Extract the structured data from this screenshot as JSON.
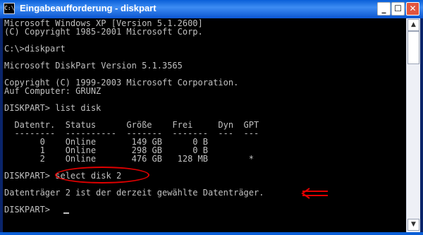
{
  "window": {
    "title": "Eingabeaufforderung - diskpart",
    "icon_text": "C:\\",
    "minimize_glyph": "_",
    "maximize_glyph": "☐",
    "close_glyph": "✕"
  },
  "console": {
    "lines": [
      "Microsoft Windows XP [Version 5.1.2600]",
      "(C) Copyright 1985-2001 Microsoft Corp.",
      "",
      "C:\\>diskpart",
      "",
      "Microsoft DiskPart Version 5.1.3565",
      "",
      "Copyright (C) 1999-2003 Microsoft Corporation.",
      "Auf Computer: GRUNZ",
      "",
      "DISKPART> list disk",
      "",
      "  Datentr.  Status      Größe    Frei     Dyn  GPT",
      "  --------  ----------  -------  -------  ---  ---",
      "       0    Online       149 GB      0 B",
      "       1    Online       298 GB      0 B",
      "       2    Online       476 GB   128 MB        *",
      "",
      "DISKPART> select disk 2",
      "",
      "Datenträger 2 ist der derzeit gewählte Datenträger.",
      "",
      "DISKPART> "
    ]
  },
  "annotation": {
    "highlight_color": "#e00000"
  },
  "colors": {
    "console_bg": "#000000",
    "console_text": "#c0c0c0",
    "titlebar": "#0a5fd8"
  }
}
